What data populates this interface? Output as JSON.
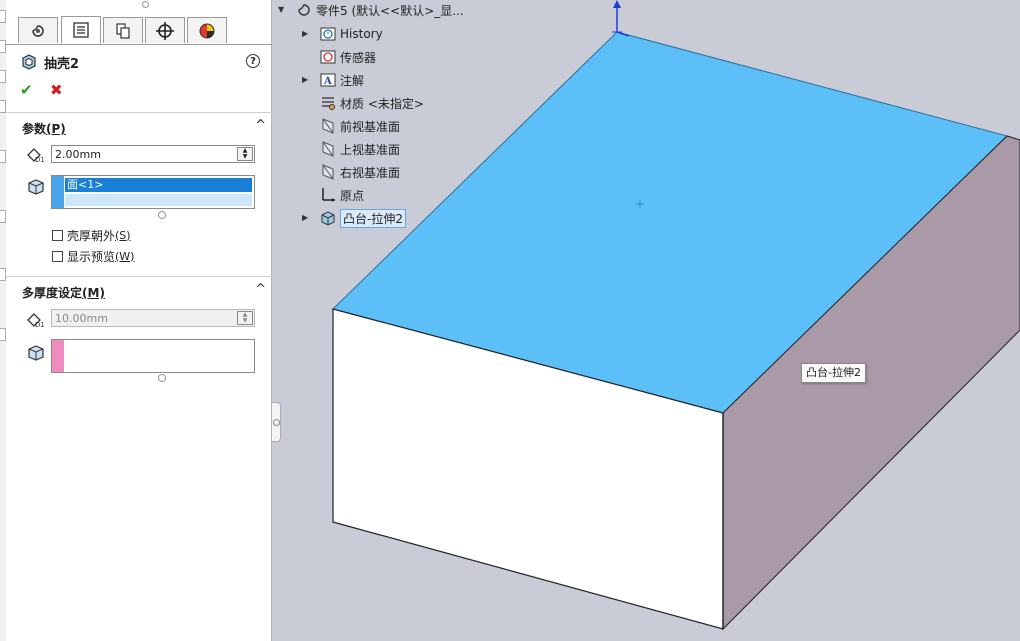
{
  "property_manager": {
    "tabs": [
      "feature-manager-tab",
      "property-manager-tab",
      "configuration-manager-tab",
      "dimxpert-tab",
      "display-manager-tab"
    ],
    "feature_name": "抽壳2",
    "help_label": "?",
    "ok_label": "✔",
    "cancel_label": "✖",
    "parameters": {
      "title": "参数",
      "title_key": "(P)",
      "thickness_value": "2.00mm",
      "faces_to_remove": [
        "面<1>"
      ],
      "shell_outward_label": "壳厚朝外",
      "shell_outward_key": "(S)",
      "show_preview_label": "显示预览",
      "show_preview_key": "(W)"
    },
    "multi_thickness": {
      "title": "多厚度设定",
      "title_key": "(M)",
      "thickness_value": "10.00mm"
    },
    "collapse_glyph": "^"
  },
  "tree": {
    "root": "零件5  (默认<<默认>_显...",
    "items": [
      {
        "label": "History",
        "icon": "history-icon",
        "expandable": true
      },
      {
        "label": "传感器",
        "icon": "sensor-icon",
        "expandable": false
      },
      {
        "label": "注解",
        "icon": "annotation-icon",
        "expandable": true
      },
      {
        "label": "材质 <未指定>",
        "icon": "material-icon",
        "expandable": false
      },
      {
        "label": "前视基准面",
        "icon": "plane-icon",
        "expandable": false
      },
      {
        "label": "上视基准面",
        "icon": "plane-icon",
        "expandable": false
      },
      {
        "label": "右视基准面",
        "icon": "plane-icon",
        "expandable": false
      },
      {
        "label": "原点",
        "icon": "origin-icon",
        "expandable": false
      },
      {
        "label": "凸台-拉伸2",
        "icon": "extrude-icon",
        "expandable": true
      }
    ]
  },
  "viewport": {
    "tooltip": "凸台-拉伸2",
    "colors": {
      "top_face": "#5dbff8",
      "front_face": "#ffffff",
      "side_face": "#aa9aa8",
      "background": "#c9ccd6"
    }
  }
}
